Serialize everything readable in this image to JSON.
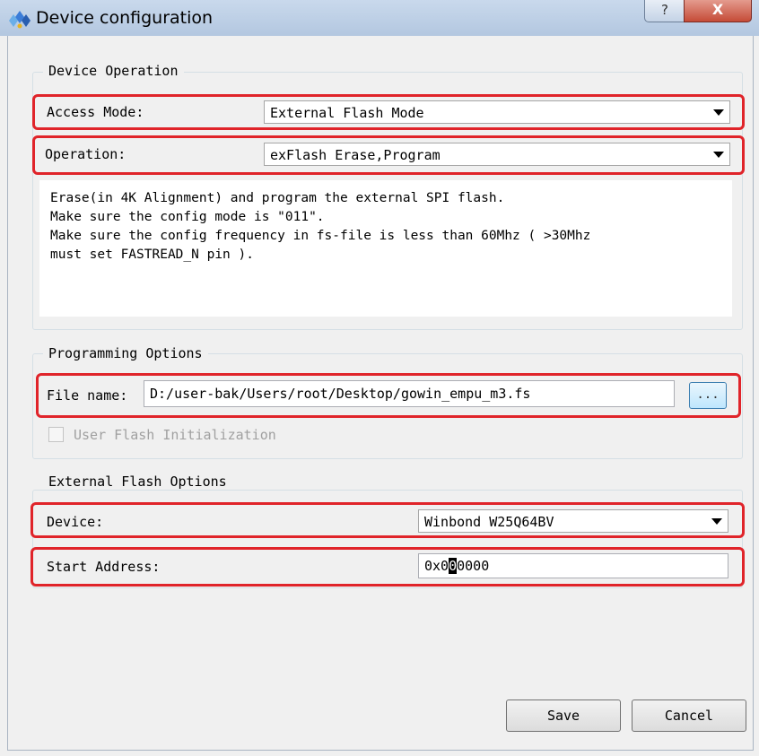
{
  "window": {
    "title": "Device configuration",
    "help_label": "?",
    "close_label": "X"
  },
  "device_operation": {
    "group_title": "Device Operation",
    "access_mode_label": "Access Mode:",
    "access_mode_value": "External Flash Mode",
    "operation_label": "Operation:",
    "operation_value": "exFlash Erase,Program",
    "description": "Erase(in 4K Alignment) and program the external SPI flash.\nMake sure the config mode is \"011\".\nMake sure the config frequency in fs-file is less than 60Mhz ( >30Mhz\nmust set FASTREAD_N pin )."
  },
  "programming_options": {
    "group_title": "Programming Options",
    "file_name_label": "File name:",
    "file_name_value": "D:/user-bak/Users/root/Desktop/gowin_empu_m3.fs",
    "browse_label": "...",
    "user_flash_init_label": "User Flash Initialization",
    "user_flash_init_checked": false
  },
  "external_flash_options": {
    "group_title": "External Flash Options",
    "device_label": "Device:",
    "device_value": "Winbond W25Q64BV",
    "start_address_label": "Start Address:",
    "start_address_prefix": "0x0",
    "start_address_caret": "0",
    "start_address_suffix": "0000"
  },
  "buttons": {
    "save": "Save",
    "cancel": "Cancel"
  },
  "colors": {
    "highlight_box": "#e0242a",
    "titlebar": "#bccde4",
    "close_button": "#c54b37"
  },
  "icons": {
    "app": "gowin-logo-icon",
    "dropdown": "chevron-down-icon"
  }
}
